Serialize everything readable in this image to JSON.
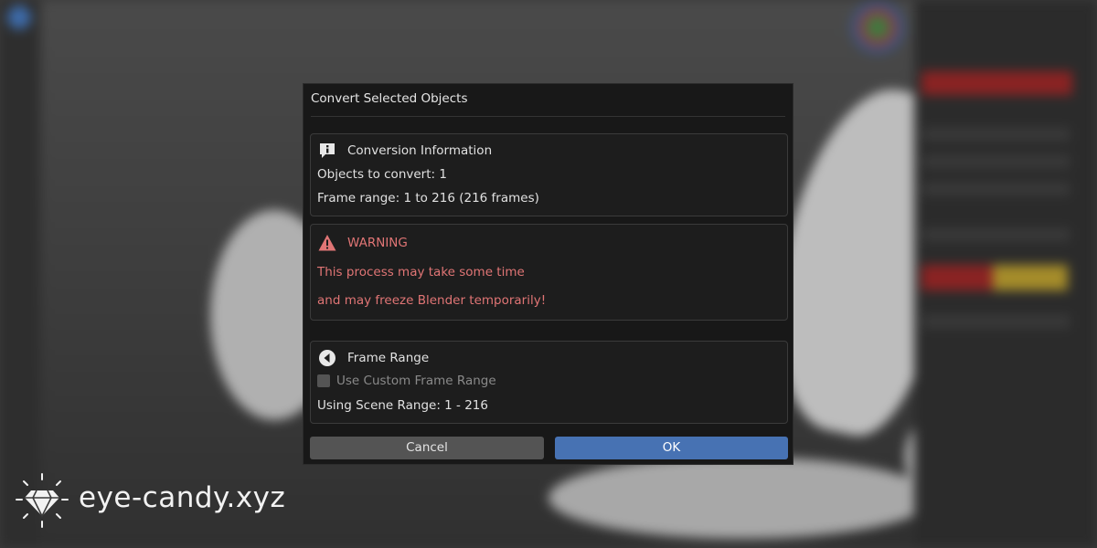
{
  "dialog": {
    "title": "Convert Selected Objects",
    "conversion_info": {
      "heading": "Conversion Information",
      "icon": "info-icon",
      "objects_line": "Objects to convert: 1",
      "frame_line": "Frame range: 1 to 216 (216 frames)"
    },
    "warning": {
      "heading": "WARNING",
      "icon": "warning-triangle-icon",
      "line1": "This process may take some time",
      "line2": "and may freeze Blender temporarily!",
      "color": "#e07575"
    },
    "frame_range": {
      "heading": "Frame Range",
      "icon": "back-arrow-icon",
      "checkbox_label": "Use Custom Frame Range",
      "checkbox_checked": false,
      "scene_range_line": "Using Scene Range: 1 - 216"
    },
    "buttons": {
      "cancel_label": "Cancel",
      "ok_label": "OK",
      "ok_color": "#4772b3"
    }
  },
  "watermark": {
    "text": "eye-candy.xyz",
    "icon": "diamond-logo-icon"
  }
}
